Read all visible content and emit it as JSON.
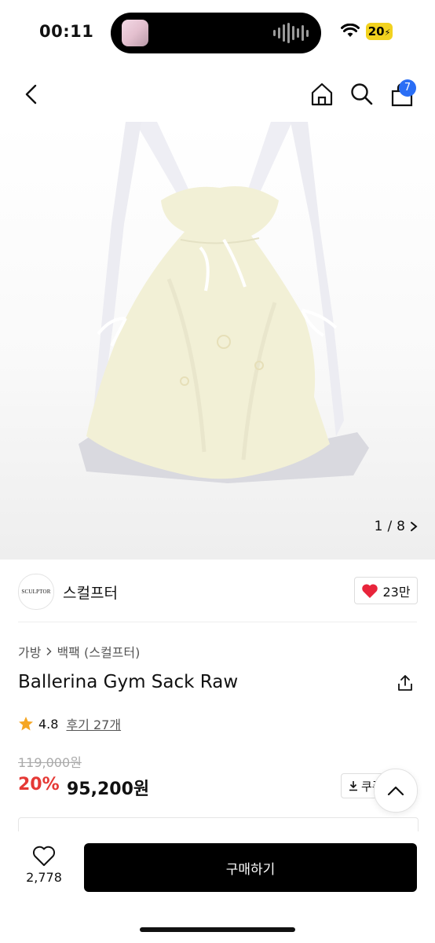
{
  "status_bar": {
    "time": "00:11",
    "battery": "20"
  },
  "nav": {
    "cart_count": "7"
  },
  "gallery": {
    "current": "1",
    "separator": "/",
    "total": "8"
  },
  "brand": {
    "logo_text": "SCULPTOR",
    "name": "스컬프터",
    "likes": "23만"
  },
  "breadcrumb": {
    "category": "가방",
    "subcategory": "백팩 (스컬프터)"
  },
  "product": {
    "title": "Ballerina Gym Sack Raw",
    "rating": "4.8",
    "review_label": "후기 27개",
    "original_price": "119,000원",
    "discount": "20%",
    "sale_price": "95,200원",
    "coupon_label": "쿠폰"
  },
  "bottom_bar": {
    "wish_count": "2,778",
    "buy_label": "구매하기"
  },
  "colors": {
    "accent_red": "#e53935",
    "badge_blue": "#2a6ef5",
    "rating_star": "#f5a623",
    "heart": "#e8243b"
  }
}
